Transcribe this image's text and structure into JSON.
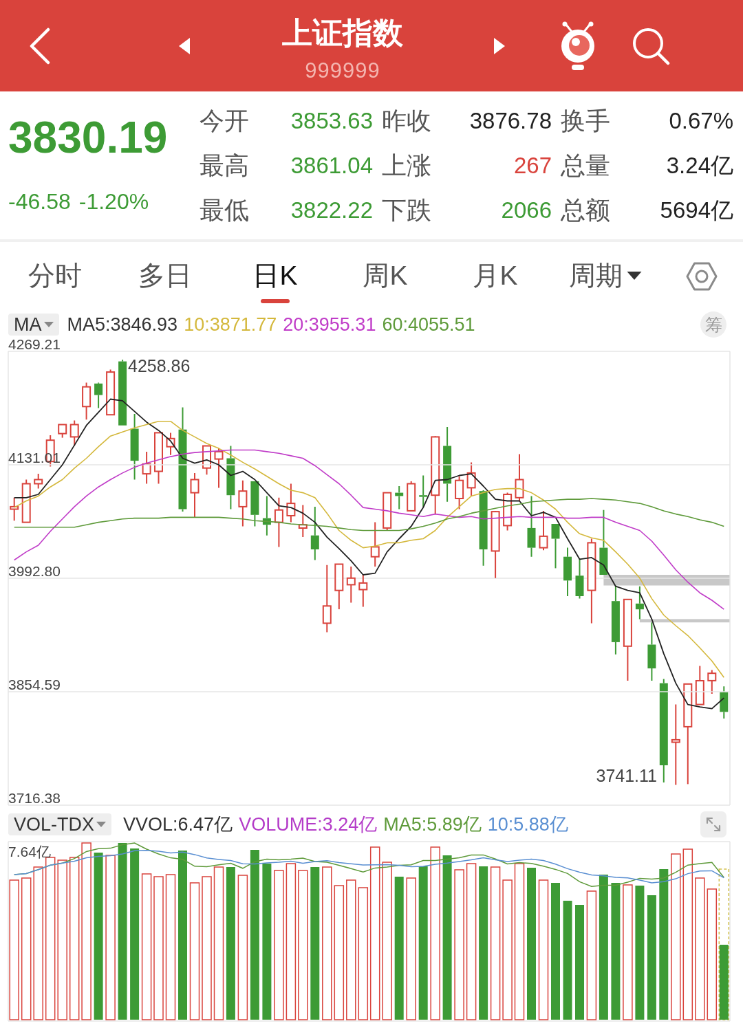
{
  "header": {
    "title": "上证指数",
    "code": "999999"
  },
  "quote": {
    "price": "3830.19",
    "change": "-46.58",
    "change_percent": "-1.20%",
    "color": "#3d9b35"
  },
  "stats": [
    [
      {
        "label": "今开",
        "value": "3853.63",
        "color": "#3d9b35"
      },
      {
        "label": "昨收",
        "value": "3876.78",
        "color": "#222222"
      },
      {
        "label": "换手",
        "value": "0.67%",
        "color": "#222222"
      }
    ],
    [
      {
        "label": "最高",
        "value": "3861.04",
        "color": "#3d9b35"
      },
      {
        "label": "上涨",
        "value": "267",
        "color": "#d9433c"
      },
      {
        "label": "总量",
        "value": "3.24亿",
        "color": "#222222"
      }
    ],
    [
      {
        "label": "最低",
        "value": "3822.22",
        "color": "#3d9b35"
      },
      {
        "label": "下跌",
        "value": "2066",
        "color": "#3d9b35"
      },
      {
        "label": "总额",
        "value": "5694亿",
        "color": "#222222"
      }
    ]
  ],
  "tabs": [
    {
      "label": "分时",
      "selected": false,
      "kind": "tab"
    },
    {
      "label": "多日",
      "selected": false,
      "kind": "tab"
    },
    {
      "label": "日K",
      "selected": true,
      "kind": "tab"
    },
    {
      "label": "周K",
      "selected": false,
      "kind": "tab"
    },
    {
      "label": "月K",
      "selected": false,
      "kind": "tab"
    },
    {
      "label": "周期",
      "selected": false,
      "kind": "dropdown"
    }
  ],
  "indicators": {
    "selector": "MA",
    "items": [
      {
        "label": "MA5:3846.93",
        "color": "#333333"
      },
      {
        "label": "10:3871.77",
        "color": "#d4b83c"
      },
      {
        "label": "20:3955.31",
        "color": "#c03cc8"
      },
      {
        "label": "60:4055.51",
        "color": "#5e9a3a"
      }
    ],
    "button": "筹"
  },
  "price_chart": {
    "chart_data": {
      "type": "candlestick",
      "grid": true,
      "ylim": [
        3716.38,
        4269.21
      ],
      "yticks": [
        3716.38,
        {
          "value": 3992.8,
          "label": "3992.80"
        },
        4269.21
      ],
      "ohlc": [
        [
          4077,
          4091,
          4063,
          4080
        ],
        [
          4061,
          4113,
          4061,
          4108
        ],
        [
          4108,
          4120,
          4102,
          4113
        ],
        [
          4135,
          4167,
          4129,
          4161
        ],
        [
          4169,
          4180,
          4164,
          4180
        ],
        [
          4165,
          4185,
          4154,
          4180
        ],
        [
          4202,
          4231,
          4186,
          4226
        ],
        [
          4230,
          4231,
          4200,
          4216
        ],
        [
          4192,
          4247,
          4192,
          4244
        ],
        [
          4257,
          4259,
          4179,
          4179
        ],
        [
          4175,
          4193,
          4113,
          4136
        ],
        [
          4120,
          4147,
          4108,
          4132
        ],
        [
          4123,
          4170,
          4108,
          4170
        ],
        [
          4153,
          4170,
          4143,
          4163
        ],
        [
          4174,
          4201,
          4074,
          4077
        ],
        [
          4097,
          4121,
          4067,
          4113
        ],
        [
          4127,
          4154,
          4119,
          4154
        ],
        [
          4138,
          4151,
          4103,
          4147
        ],
        [
          4139,
          4154,
          4077,
          4094
        ],
        [
          4080,
          4112,
          4056,
          4099
        ],
        [
          4111,
          4111,
          4056,
          4070
        ],
        [
          4066,
          4093,
          4045,
          4058
        ],
        [
          4061,
          4091,
          4031,
          4076
        ],
        [
          4069,
          4108,
          4061,
          4084
        ],
        [
          4054,
          4082,
          4043,
          4058
        ],
        [
          4045,
          4080,
          4015,
          4028
        ],
        [
          3938,
          4009,
          3927,
          3959
        ],
        [
          3978,
          4010,
          3955,
          4010
        ],
        [
          3985,
          4007,
          3963,
          3993
        ],
        [
          3979,
          3997,
          3958,
          3987
        ],
        [
          4019,
          4061,
          4007,
          4031
        ],
        [
          4054,
          4097,
          4051,
          4097
        ],
        [
          4097,
          4105,
          4077,
          4093
        ],
        [
          4075,
          4111,
          4075,
          4108
        ],
        [
          4094,
          4118,
          4080,
          4092
        ],
        [
          4094,
          4166,
          4071,
          4165
        ],
        [
          4154,
          4177,
          4086,
          4108
        ],
        [
          4090,
          4117,
          4077,
          4112
        ],
        [
          4103,
          4134,
          4093,
          4121
        ],
        [
          4099,
          4100,
          4008,
          4028
        ],
        [
          4026,
          4075,
          3993,
          4074
        ],
        [
          4057,
          4097,
          4051,
          4095
        ],
        [
          4091,
          4144,
          4087,
          4113
        ],
        [
          4054,
          4093,
          4019,
          4030
        ],
        [
          4030,
          4075,
          4027,
          4044
        ],
        [
          4059,
          4059,
          4005,
          4041
        ],
        [
          4019,
          4030,
          3971,
          3990
        ],
        [
          3996,
          4017,
          3968,
          3971
        ],
        [
          3978,
          4041,
          3938,
          4036
        ],
        [
          4030,
          4076,
          3997,
          3997
        ],
        [
          3965,
          3984,
          3900,
          3915
        ],
        [
          3910,
          3967,
          3868,
          3967
        ],
        [
          3962,
          3983,
          3943,
          3955
        ],
        [
          3912,
          3939,
          3868,
          3883
        ],
        [
          3865,
          3870,
          3744,
          3765
        ],
        [
          3793,
          3839,
          3741,
          3796
        ],
        [
          3812,
          3864,
          3742,
          3864
        ],
        [
          3839,
          3886,
          3839,
          3868
        ],
        [
          3868,
          3881,
          3852,
          3877
        ],
        [
          3854,
          3861,
          3822,
          3830
        ]
      ]
    },
    "high_label": "4258.86",
    "low_label": "3741.11"
  },
  "moving_averages": {
    "chart_data": {
      "type": "line",
      "grid": true,
      "ylim": [
        3716.38,
        4269.21
      ],
      "yticks": [
        3854.59,
        4131.01
      ],
      "series": [
        {
          "color": "#222222",
          "values": [
            4091,
            4091,
            4095,
            4113,
            4131,
            4155,
            4179,
            4195,
            4211,
            4209,
            4196,
            4183,
            4173,
            4160,
            4139,
            4133,
            4137,
            4131,
            4118,
            4123,
            4113,
            4097,
            4081,
            4079,
            4072,
            4061,
            4043,
            4029,
            4014,
            3997,
            3999,
            4025,
            4041,
            4056,
            4079,
            4112,
            4113,
            4118,
            4120,
            4105,
            4089,
            4087,
            4087,
            4069,
            4073,
            4067,
            4041,
            4016,
            4018,
            4009,
            3983,
            3978,
            3975,
            3943,
            3901,
            3865,
            3839,
            3836,
            3834,
            3847
          ]
        },
        {
          "color": "#d4b83c",
          "values": [
            4079,
            4087,
            4093,
            4104,
            4113,
            4127,
            4139,
            4153,
            4166,
            4171,
            4176,
            4180,
            4184,
            4184,
            4173,
            4165,
            4157,
            4151,
            4143,
            4134,
            4126,
            4117,
            4108,
            4100,
            4097,
            4091,
            4072,
            4051,
            4039,
            4030,
            4032,
            4036,
            4036,
            4039,
            4041,
            4051,
            4067,
            4080,
            4093,
            4097,
            4101,
            4102,
            4102,
            4097,
            4088,
            4077,
            4061,
            4047,
            4042,
            4039,
            4025,
            4010,
            3993,
            3968,
            3948,
            3935,
            3923,
            3908,
            3892,
            3872
          ]
        },
        {
          "color": "#c03cc8",
          "values": [
            4015,
            4025,
            4033,
            4050,
            4065,
            4080,
            4093,
            4104,
            4113,
            4121,
            4128,
            4133,
            4137,
            4141,
            4144,
            4146,
            4147,
            4148,
            4149,
            4149,
            4149,
            4147,
            4145,
            4142,
            4139,
            4130,
            4119,
            4108,
            4094,
            4079,
            4077,
            4075,
            4072,
            4070,
            4068,
            4071,
            4069,
            4067,
            4068,
            4065,
            4066,
            4067,
            4068,
            4067,
            4067,
            4067,
            4066,
            4066,
            4067,
            4067,
            4061,
            4056,
            4051,
            4038,
            4021,
            4003,
            3988,
            3975,
            3966,
            3955
          ]
        },
        {
          "color": "#5e9a3a",
          "values": [
            4055,
            4055,
            4055,
            4055,
            4055,
            4055,
            4058,
            4061,
            4063,
            4065,
            4066,
            4066,
            4066,
            4067,
            4067,
            4067,
            4067,
            4067,
            4066,
            4065,
            4063,
            4062,
            4061,
            4059,
            4058,
            4057,
            4056,
            4054,
            4052,
            4051,
            4051,
            4051,
            4051,
            4053,
            4056,
            4060,
            4065,
            4068,
            4072,
            4075,
            4078,
            4081,
            4083,
            4086,
            4087,
            4088,
            4089,
            4089,
            4090,
            4089,
            4088,
            4086,
            4084,
            4080,
            4075,
            4071,
            4068,
            4064,
            4061,
            4056
          ]
        }
      ]
    }
  },
  "volume_indicators": {
    "selector": "VOL-TDX",
    "items": [
      {
        "label": "VVOL:6.47亿",
        "color": "#333333"
      },
      {
        "label": "VOLUME:3.24亿",
        "color": "#b43cc8"
      },
      {
        "label": "MA5:5.89亿",
        "color": "#5e9a3a"
      },
      {
        "label": "10:5.88亿",
        "color": "#5a8fd2"
      }
    ]
  },
  "volume_chart": {
    "max_label": "7.64亿"
  }
}
